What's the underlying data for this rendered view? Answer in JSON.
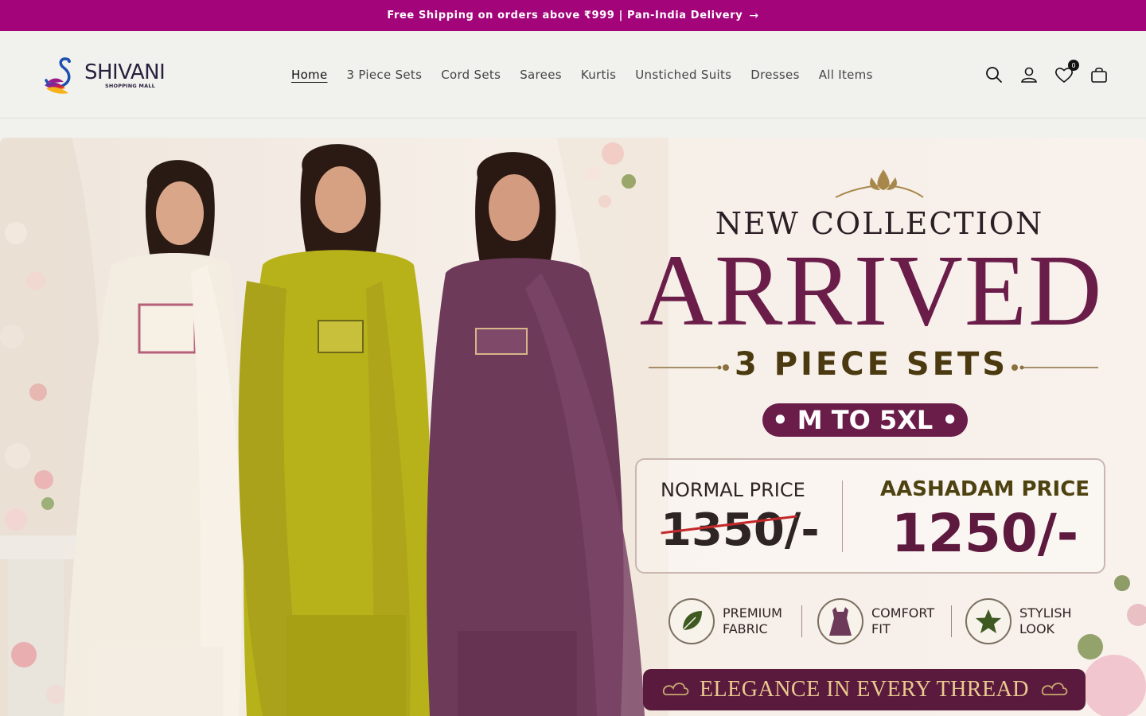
{
  "announcement": {
    "text": "Free Shipping on orders above ₹999 | Pan-India Delivery",
    "arrow": "→"
  },
  "header": {
    "logo": {
      "name": "SHIVANI",
      "tagline": "SHOPPING MALL"
    },
    "nav": [
      {
        "label": "Home",
        "active": true
      },
      {
        "label": "3 Piece Sets"
      },
      {
        "label": "Cord Sets"
      },
      {
        "label": "Sarees"
      },
      {
        "label": "Kurtis"
      },
      {
        "label": "Unstiched Suits"
      },
      {
        "label": "Dresses"
      },
      {
        "label": "All Items"
      }
    ],
    "icons": [
      "search-icon",
      "account-icon",
      "wishlist-icon",
      "cart-icon"
    ],
    "wishlist_count": "0"
  },
  "hero": {
    "heading_top": "NEW COLLECTION",
    "heading_main": "ARRIVED",
    "subheading": "3 PIECE SETS",
    "size_badge": "• M TO 5XL •",
    "normal_price_label": "NORMAL PRICE",
    "normal_price_value": "1350/-",
    "aashadam_price_label": "AASHADAM PRICE",
    "aashadam_price_value": "1250/-",
    "features": [
      {
        "line1": "PREMIUM",
        "line2": "FABRIC",
        "icon": "leaf-icon"
      },
      {
        "line1": "COMFORT",
        "line2": "FIT",
        "icon": "dress-icon"
      },
      {
        "line1": "STYLISH",
        "line2": "LOOK",
        "icon": "star-icon"
      }
    ],
    "banner": "ELEGANCE IN EVERY THREAD"
  },
  "colors": {
    "announcement_bg": "#a3047a",
    "header_bg": "#f1f2ee",
    "brand_maroon": "#6b1d4a",
    "gold": "#4b3a0f"
  }
}
